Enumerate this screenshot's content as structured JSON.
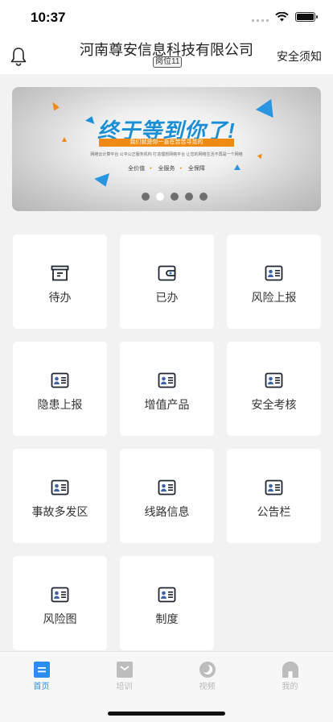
{
  "status_bar": {
    "time": "10:37"
  },
  "header": {
    "company_name": "河南尊安信息科技有限公司",
    "post_badge": "岗位11",
    "notice_link": "安全须知",
    "bell_icon": "bell-icon"
  },
  "banner": {
    "title": "终于等到你了!",
    "stripe_text": "我们就是你一直在苦苦寻觅的",
    "small_text": "网络云计算平台 公平公正服务机构 打造理想网络平台 让您的网络生活不再是一个网络",
    "tags": [
      "全价值",
      "全服务",
      "全保障"
    ],
    "slide_count": 5,
    "active_slide": 2
  },
  "grid": {
    "items": [
      {
        "label": "待办",
        "icon": "inbox-icon"
      },
      {
        "label": "已办",
        "icon": "wallet-icon"
      },
      {
        "label": "风险上报",
        "icon": "id-card-icon"
      },
      {
        "label": "隐患上报",
        "icon": "id-card-icon"
      },
      {
        "label": "增值产品",
        "icon": "id-card-icon"
      },
      {
        "label": "安全考核",
        "icon": "id-card-icon"
      },
      {
        "label": "事故多发区",
        "icon": "id-card-icon"
      },
      {
        "label": "线路信息",
        "icon": "id-card-icon"
      },
      {
        "label": "公告栏",
        "icon": "id-card-icon"
      },
      {
        "label": "风险图",
        "icon": "id-card-icon"
      },
      {
        "label": "制度",
        "icon": "id-card-icon"
      }
    ]
  },
  "tabbar": {
    "items": [
      {
        "label": "首页",
        "icon": "home-icon",
        "active": true
      },
      {
        "label": "培训",
        "icon": "training-icon",
        "active": false
      },
      {
        "label": "视频",
        "icon": "video-icon",
        "active": false
      },
      {
        "label": "我的",
        "icon": "profile-icon",
        "active": false
      }
    ]
  },
  "colors": {
    "accent": "#2c8df0",
    "banner_blue": "#1a8fd6",
    "banner_orange": "#f08a12"
  }
}
